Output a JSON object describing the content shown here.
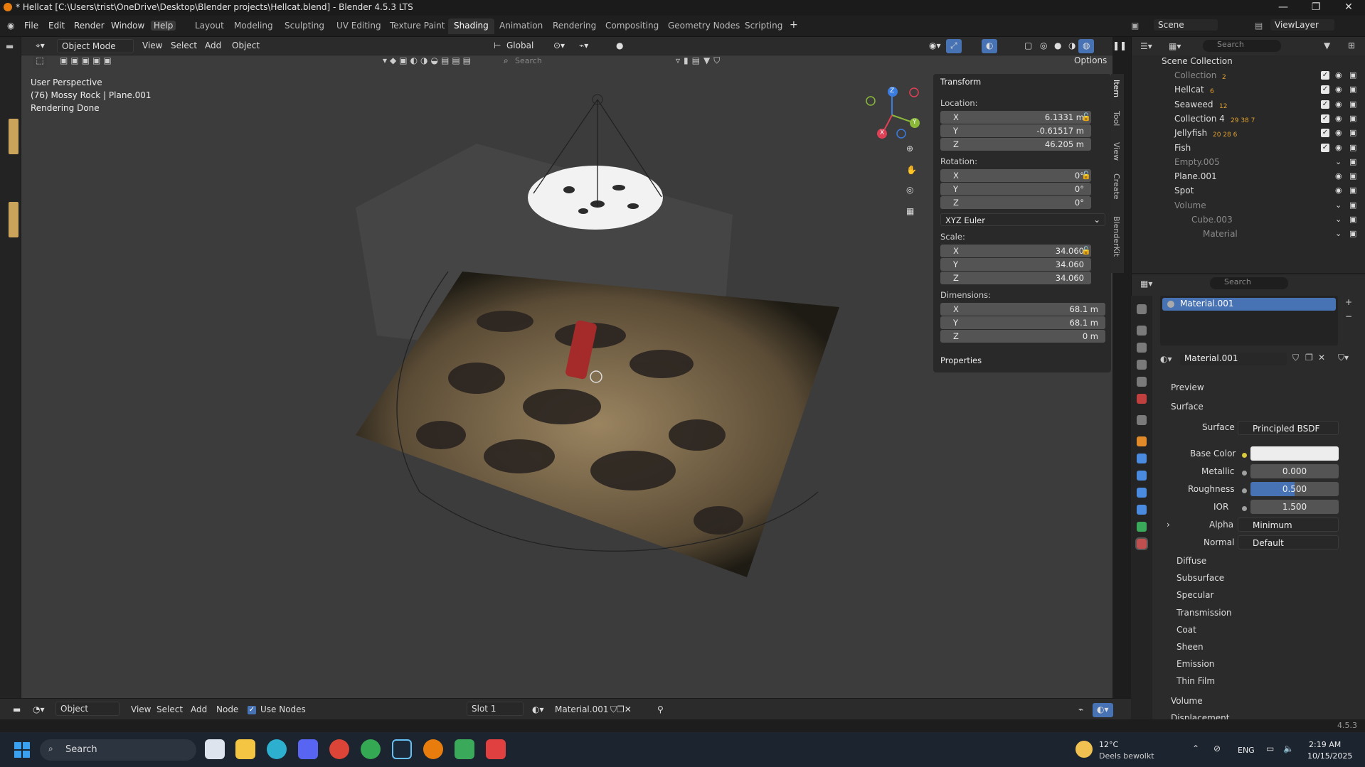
{
  "window": {
    "title": "* Hellcat [C:\\Users\\trist\\OneDrive\\Desktop\\Blender projects\\Hellcat.blend] - Blender 4.5.3 LTS",
    "controls": [
      "—",
      "❐",
      "✕"
    ]
  },
  "menu": {
    "items": [
      "File",
      "Edit",
      "Render",
      "Window",
      "Help"
    ],
    "workspaces": [
      "Layout",
      "Modeling",
      "Sculpting",
      "UV Editing",
      "Texture Paint",
      "Shading",
      "Animation",
      "Rendering",
      "Compositing",
      "Geometry Nodes",
      "Scripting"
    ],
    "active_workspace": "Shading",
    "add_tab": "+",
    "scene": "Scene",
    "view_layer": "ViewLayer"
  },
  "viewport_header": {
    "mode": "Object Mode",
    "menus": [
      "View",
      "Select",
      "Add",
      "Object"
    ],
    "orientation": "Global",
    "search_placeholder": "Search",
    "options": "Options"
  },
  "viewport_info": {
    "line1": "User Perspective",
    "line2": "(76) Mossy Rock | Plane.001",
    "line3": "Rendering Done"
  },
  "gizmo": {
    "x": "X",
    "y": "Y",
    "z": "Z"
  },
  "npanel": {
    "transform_title": "Transform",
    "location_label": "Location:",
    "location": [
      {
        "axis": "X",
        "value": "6.1331 m"
      },
      {
        "axis": "Y",
        "value": "-0.61517 m"
      },
      {
        "axis": "Z",
        "value": "46.205 m"
      }
    ],
    "rotation_label": "Rotation:",
    "rotation": [
      {
        "axis": "X",
        "value": "0°"
      },
      {
        "axis": "Y",
        "value": "0°"
      },
      {
        "axis": "Z",
        "value": "0°"
      }
    ],
    "rotation_mode": "XYZ Euler",
    "scale_label": "Scale:",
    "scale": [
      {
        "axis": "X",
        "value": "34.060"
      },
      {
        "axis": "Y",
        "value": "34.060"
      },
      {
        "axis": "Z",
        "value": "34.060"
      }
    ],
    "dimensions_label": "Dimensions:",
    "dimensions": [
      {
        "axis": "X",
        "value": "68.1 m"
      },
      {
        "axis": "Y",
        "value": "68.1 m"
      },
      {
        "axis": "Z",
        "value": "0 m"
      }
    ],
    "properties_title": "Properties",
    "tabs": [
      "Item",
      "Tool",
      "View",
      "Create",
      "BlenderKit"
    ]
  },
  "outliner": {
    "search_placeholder": "Search",
    "root": "Scene Collection",
    "items": [
      {
        "name": "Collection",
        "badge": "2",
        "dim": true
      },
      {
        "name": "Hellcat",
        "badge": "6",
        "dim": false
      },
      {
        "name": "Seaweed",
        "badge": "12",
        "dim": false
      },
      {
        "name": "Collection 4",
        "badge": "29 38 7",
        "dim": false
      },
      {
        "name": "Jellyfish",
        "badge": "20 28 6",
        "dim": false
      },
      {
        "name": "Fish",
        "badge": "",
        "dim": false
      },
      {
        "name": "Empty.005",
        "badge": "",
        "dim": true
      },
      {
        "name": "Plane.001",
        "badge": "",
        "dim": false
      },
      {
        "name": "Spot",
        "badge": "",
        "dim": false
      },
      {
        "name": "Volume",
        "badge": "",
        "dim": true
      },
      {
        "name": "Cube.003",
        "badge": "",
        "dim": true
      },
      {
        "name": "Material",
        "badge": "",
        "dim": true
      }
    ]
  },
  "properties": {
    "search_placeholder": "Search",
    "material_slot": "Material.001",
    "material_name": "Material.001",
    "preview": "Preview",
    "surface_section": "Surface",
    "surface_label": "Surface",
    "surface_value": "Principled BSDF",
    "base_color_label": "Base Color",
    "base_color": "#ededed",
    "metallic_label": "Metallic",
    "metallic": "0.000",
    "roughness_label": "Roughness",
    "roughness": "0.500",
    "ior_label": "IOR",
    "ior": "1.500",
    "alpha_label": "Alpha",
    "alpha_value": "Minimum",
    "normal_label": "Normal",
    "normal_value": "Default",
    "subpanels": [
      "Diffuse",
      "Subsurface",
      "Specular",
      "Transmission",
      "Coat",
      "Sheen",
      "Emission",
      "Thin Film"
    ],
    "volume": "Volume",
    "displacement": "Displacement"
  },
  "node_header": {
    "type": "Object",
    "menus": [
      "View",
      "Select",
      "Add",
      "Node"
    ],
    "use_nodes": "Use Nodes",
    "slot": "Slot 1",
    "material": "Material.001"
  },
  "status": {
    "version": "4.5.3"
  },
  "taskbar": {
    "search": "Search",
    "weather_temp": "12°C",
    "weather_desc": "Deels bewolkt",
    "lang": "ENG",
    "time": "2:19 AM",
    "date": "10/15/2025"
  }
}
